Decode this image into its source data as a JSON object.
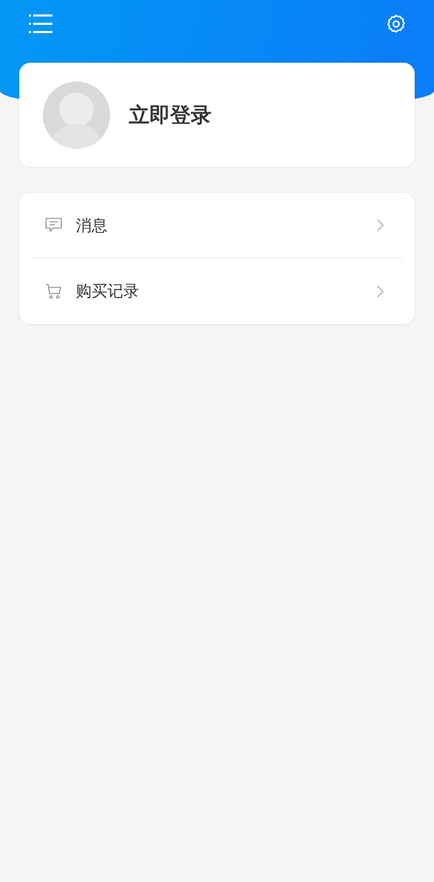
{
  "profile": {
    "login_label": "立即登录"
  },
  "menu": [
    {
      "kind": "message",
      "label": "消息"
    },
    {
      "kind": "cart",
      "label": "购买记录"
    }
  ]
}
